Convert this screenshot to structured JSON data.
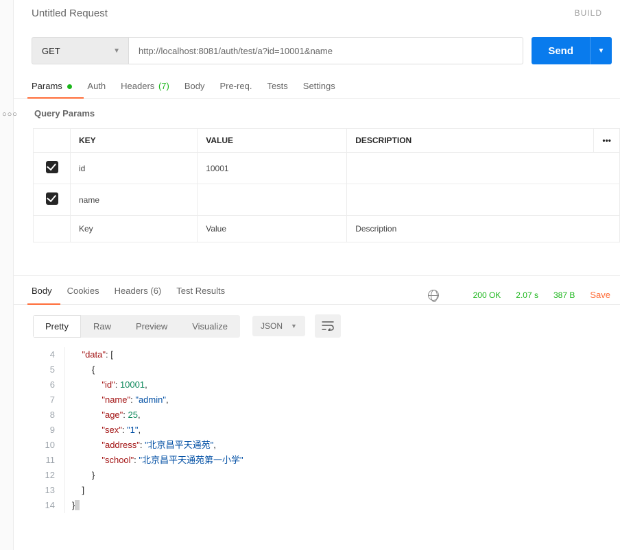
{
  "title": "Untitled Request",
  "build": "BUILD",
  "method": "GET",
  "url": "http://localhost:8081/auth/test/a?id=10001&name",
  "send_label": "Send",
  "req_tabs": {
    "params": {
      "label": "Params"
    },
    "auth": "Auth",
    "headers": "Headers",
    "headers_count": "(7)",
    "body": "Body",
    "prereq": "Pre-req.",
    "tests": "Tests",
    "settings": "Settings"
  },
  "query_params": {
    "title": "Query Params",
    "cols": {
      "key": "KEY",
      "value": "VALUE",
      "desc": "DESCRIPTION"
    },
    "rows": [
      {
        "enabled": true,
        "key": "id",
        "value": "10001",
        "desc": ""
      },
      {
        "enabled": true,
        "key": "name",
        "value": "",
        "desc": ""
      }
    ],
    "placeholders": {
      "key": "Key",
      "value": "Value",
      "desc": "Description"
    }
  },
  "resp_tabs": {
    "body": "Body",
    "cookies": "Cookies",
    "headers": "Headers",
    "headers_count": "(6)",
    "tests": "Test Results"
  },
  "status": {
    "code": "200 OK",
    "time": "2.07 s",
    "size": "387 B",
    "save": "Save"
  },
  "view_modes": {
    "pretty": "Pretty",
    "raw": "Raw",
    "preview": "Preview",
    "visualize": "Visualize"
  },
  "format": "JSON",
  "wrap_glyph": "⤸",
  "response_body": {
    "data": [
      {
        "id": 10001,
        "name": "admin",
        "age": 25,
        "sex": "1",
        "address": "北京昌平天通苑",
        "school": "北京昌平天通苑第一小学"
      }
    ]
  },
  "line_start": 4,
  "line_end": 14,
  "chevron": "▼",
  "more_dots": "○○○",
  "desc_dots": "•••"
}
